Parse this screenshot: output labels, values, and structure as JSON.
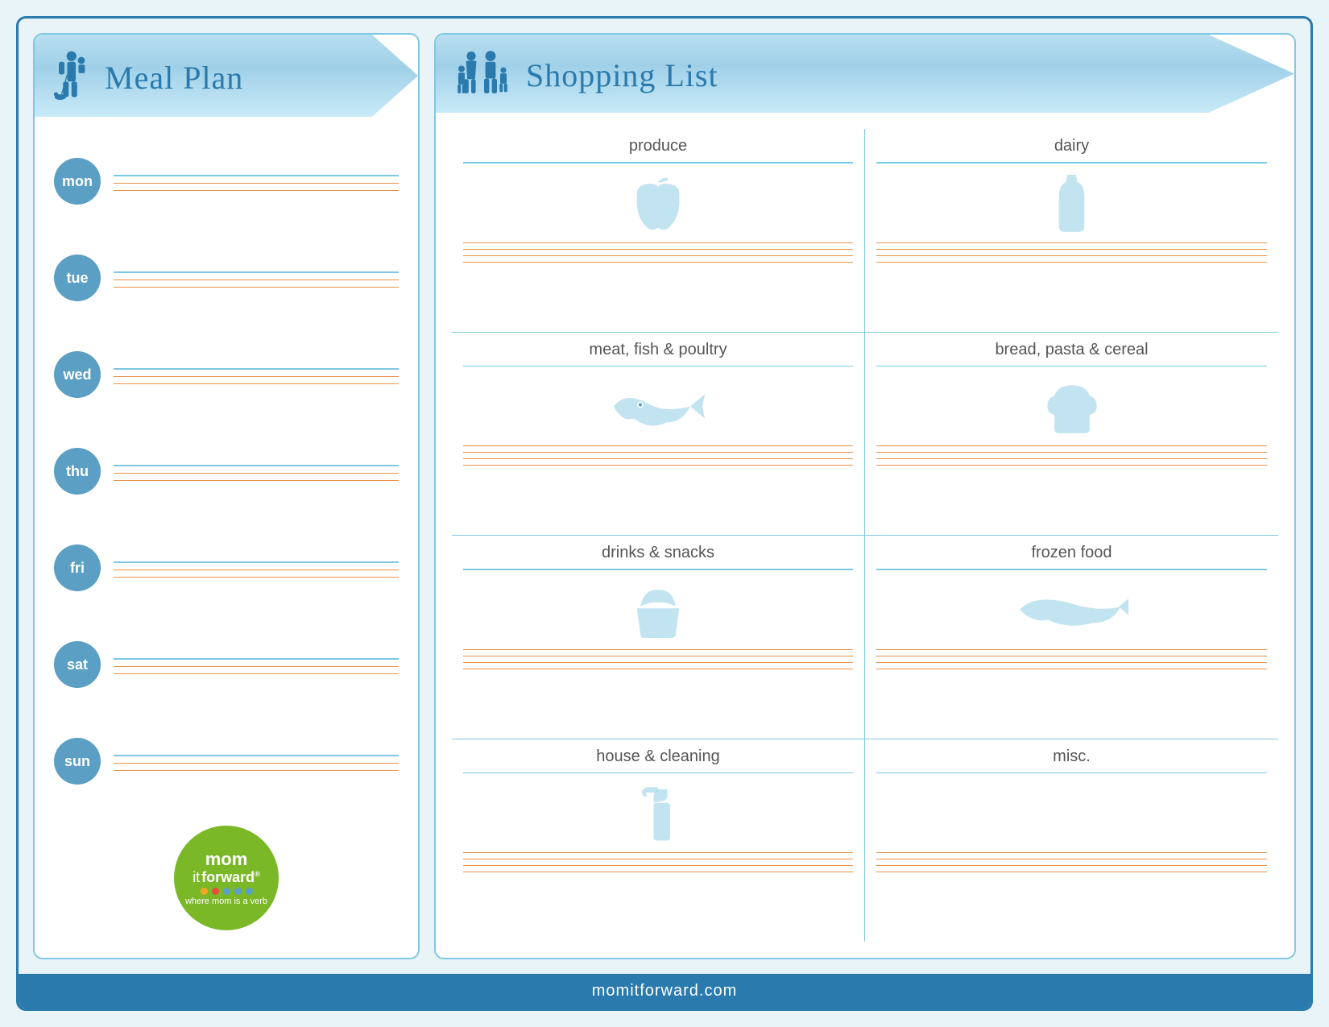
{
  "mealPlan": {
    "title": "Meal Plan",
    "days": [
      {
        "label": "mon"
      },
      {
        "label": "tue"
      },
      {
        "label": "wed"
      },
      {
        "label": "thu"
      },
      {
        "label": "fri"
      },
      {
        "label": "sat"
      },
      {
        "label": "sun"
      }
    ]
  },
  "shoppingList": {
    "title": "Shopping List",
    "sections": [
      {
        "id": "produce",
        "label": "produce",
        "position": "top-left"
      },
      {
        "id": "dairy",
        "label": "dairy",
        "position": "top-right"
      },
      {
        "id": "meat",
        "label": "meat, fish & poultry",
        "position": "mid-left"
      },
      {
        "id": "bread",
        "label": "bread, pasta & cereal",
        "position": "mid-right"
      },
      {
        "id": "drinks",
        "label": "drinks & snacks",
        "position": "bot-left"
      },
      {
        "id": "frozen",
        "label": "frozen food",
        "position": "bot-right"
      },
      {
        "id": "house",
        "label": "house & cleaning",
        "position": "last-left"
      },
      {
        "id": "misc",
        "label": "misc.",
        "position": "last-right"
      }
    ]
  },
  "logo": {
    "line1": "mom",
    "line2": "it forward",
    "registered": "®",
    "tagline": "where mom is a verb",
    "dots": [
      "#f5a623",
      "#e74c3c",
      "#3498db",
      "#3498db",
      "#3498db"
    ]
  },
  "footer": {
    "text": "momitforward.com"
  }
}
